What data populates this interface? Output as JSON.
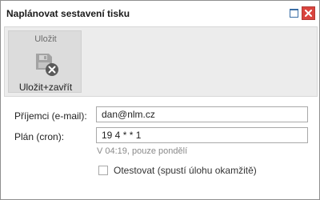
{
  "window": {
    "title": "Naplánovat sestavení tisku"
  },
  "ribbon": {
    "group_label": "Uložit",
    "save_close_label": "Uložit+zavřít"
  },
  "form": {
    "recipients_label": "Příjemci (e-mail):",
    "recipients_value": "dan@nlm.cz",
    "schedule_label": "Plán (cron):",
    "schedule_value": "19 4 * * 1",
    "schedule_hint": "V 04:19, pouze pondělí",
    "test_label": "Otestovat (spustí úlohu okamžitě)",
    "test_checked": false
  },
  "colors": {
    "close_button": "#d9443e",
    "maximize_icon": "#3a6ea5",
    "ribbon_bg": "#ececec",
    "group_bg": "#dcdcdc",
    "hint_text": "#8a8a8a"
  },
  "icons": {
    "maximize": "maximize-icon",
    "close": "close-icon",
    "save_close": "save-close-icon"
  }
}
